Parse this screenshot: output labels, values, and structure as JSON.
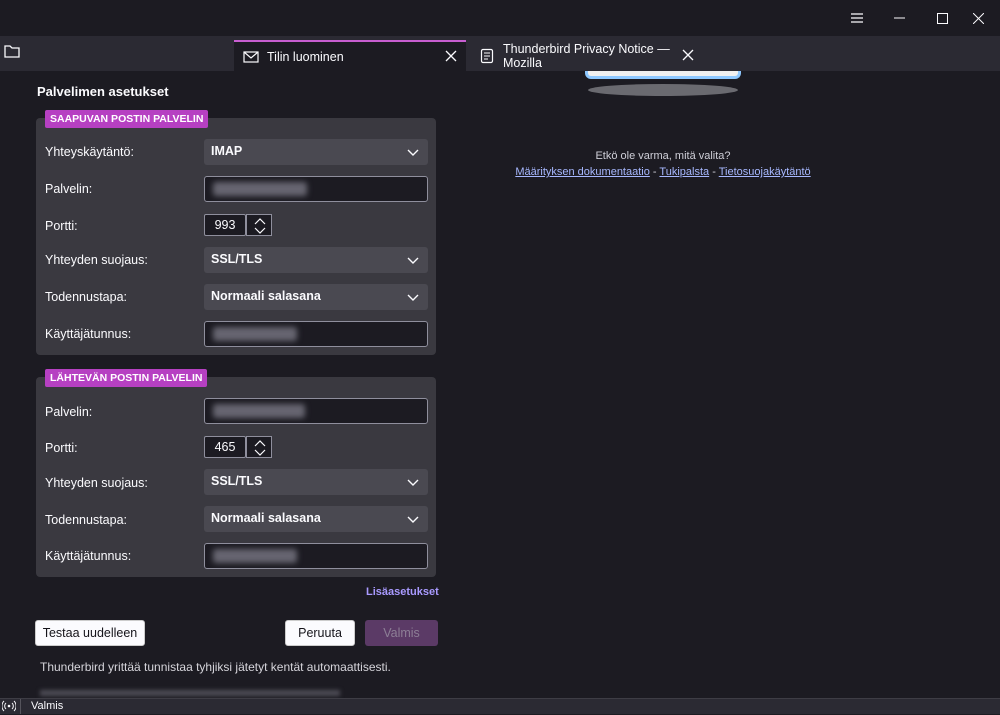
{
  "window": {
    "menu_icon": "hamburger-icon",
    "minimize_icon": "minimize-icon",
    "maximize_icon": "maximize-icon",
    "close_icon": "close-icon"
  },
  "tabs": [
    {
      "label": "Tilin luominen",
      "icon": "envelope-icon",
      "active": true
    },
    {
      "label": "Thunderbird Privacy Notice — Mozilla",
      "icon": "document-icon",
      "active": false
    }
  ],
  "heading": "Palvelimen asetukset",
  "incoming": {
    "badge": "SAAPUVAN POSTIN PALVELIN",
    "protocol_label": "Yhteyskäytäntö:",
    "protocol_value": "IMAP",
    "server_label": "Palvelin:",
    "port_label": "Portti:",
    "port_value": "993",
    "security_label": "Yhteyden suojaus:",
    "security_value": "SSL/TLS",
    "auth_label": "Todennustapa:",
    "auth_value": "Normaali salasana",
    "username_label": "Käyttäjätunnus:"
  },
  "outgoing": {
    "badge": "LÄHTEVÄN POSTIN PALVELIN",
    "server_label": "Palvelin:",
    "port_label": "Portti:",
    "port_value": "465",
    "security_label": "Yhteyden suojaus:",
    "security_value": "SSL/TLS",
    "auth_label": "Todennustapa:",
    "auth_value": "Normaali salasana",
    "username_label": "Käyttäjätunnus:"
  },
  "advanced_link": "Lisäasetukset",
  "buttons": {
    "retest": "Testaa uudelleen",
    "cancel": "Peruuta",
    "done": "Valmis"
  },
  "hint": "Thunderbird yrittää tunnistaa tyhjiksi jätetyt kentät automaattisesti.",
  "help": {
    "question": "Etkö ole varma, mitä valita?",
    "doc_link": "Määrityksen dokumentaatio",
    "sep": " - ",
    "support_link": "Tukipalsta",
    "privacy_link": "Tietosuojakäytäntö"
  },
  "status": {
    "icon": "activity-icon",
    "text": "Valmis"
  },
  "colors": {
    "accent": "#b640c2",
    "link": "#a7b8ff",
    "background": "#1c1b22",
    "panel": "#3a3940"
  }
}
